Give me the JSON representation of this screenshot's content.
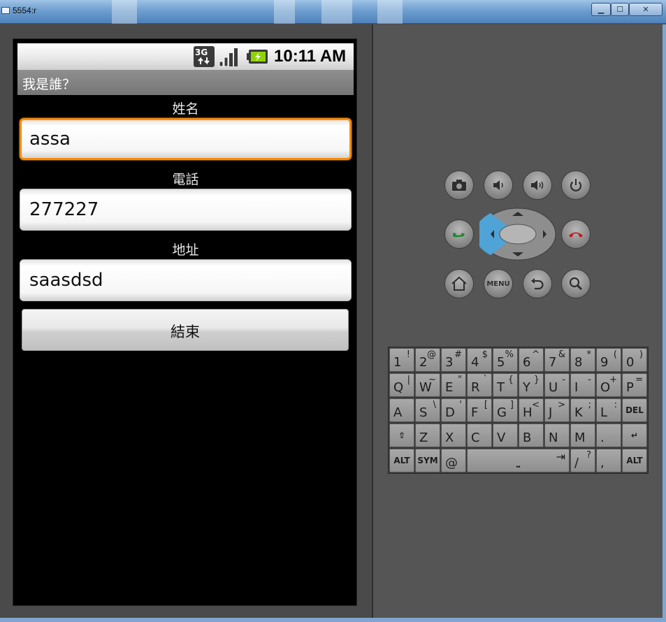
{
  "window": {
    "title": "5554:r",
    "controls": {
      "minimize": "▁",
      "maximize": "☐",
      "close": "✕"
    }
  },
  "status_bar": {
    "network": "3G",
    "time": "10:11 AM"
  },
  "app": {
    "title": "我是誰？"
  },
  "form": {
    "name_label": "姓名",
    "name_value": "assa",
    "phone_label": "電話",
    "phone_value": "277227",
    "address_label": "地址",
    "address_value": "saasdsd",
    "end_button": "結束"
  },
  "hardware": {
    "menu_label": "MENU"
  },
  "keyboard": {
    "rows": [
      [
        {
          "m": "1",
          "s": "!"
        },
        {
          "m": "2",
          "s": "@"
        },
        {
          "m": "3",
          "s": "#"
        },
        {
          "m": "4",
          "s": "$"
        },
        {
          "m": "5",
          "s": "%"
        },
        {
          "m": "6",
          "s": "^"
        },
        {
          "m": "7",
          "s": "&"
        },
        {
          "m": "8",
          "s": "*"
        },
        {
          "m": "9",
          "s": "("
        },
        {
          "m": "0",
          "s": ")"
        }
      ],
      [
        {
          "m": "Q",
          "s": "|"
        },
        {
          "m": "W",
          "s": "~"
        },
        {
          "m": "E",
          "s": "\""
        },
        {
          "m": "R",
          "s": "`"
        },
        {
          "m": "T",
          "s": "{"
        },
        {
          "m": "Y",
          "s": "}"
        },
        {
          "m": "U",
          "s": "-"
        },
        {
          "m": "I",
          "s": "-"
        },
        {
          "m": "O",
          "s": "+"
        },
        {
          "m": "P",
          "s": "="
        }
      ],
      [
        {
          "m": "A",
          "s": ""
        },
        {
          "m": "S",
          "s": "\\"
        },
        {
          "m": "D",
          "s": "'"
        },
        {
          "m": "F",
          "s": "["
        },
        {
          "m": "G",
          "s": "]"
        },
        {
          "m": "H",
          "s": "<"
        },
        {
          "m": "J",
          "s": ">"
        },
        {
          "m": "K",
          "s": ";"
        },
        {
          "m": "L",
          "s": ":"
        },
        {
          "c": "DEL"
        }
      ],
      [
        {
          "c": "⇧"
        },
        {
          "m": "Z",
          "s": ""
        },
        {
          "m": "X",
          "s": ""
        },
        {
          "m": "C",
          "s": ""
        },
        {
          "m": "V",
          "s": ""
        },
        {
          "m": "B",
          "s": ""
        },
        {
          "m": "N",
          "s": ""
        },
        {
          "m": "M",
          "s": ""
        },
        {
          "m": ".",
          "s": ""
        },
        {
          "c": "↵"
        }
      ]
    ],
    "bottom": {
      "alt_left": "ALT",
      "sym": "SYM",
      "at": "@",
      "space": "⎵",
      "tab": "⇥",
      "slash": "/",
      "question": "?",
      "comma": ",",
      "alt_right": "ALT"
    }
  },
  "colors": {
    "focus": "#ff8a00",
    "call_green": "#1a8a2a",
    "end_red": "#c8161b",
    "dpad_blue": "#4fa3d6"
  }
}
